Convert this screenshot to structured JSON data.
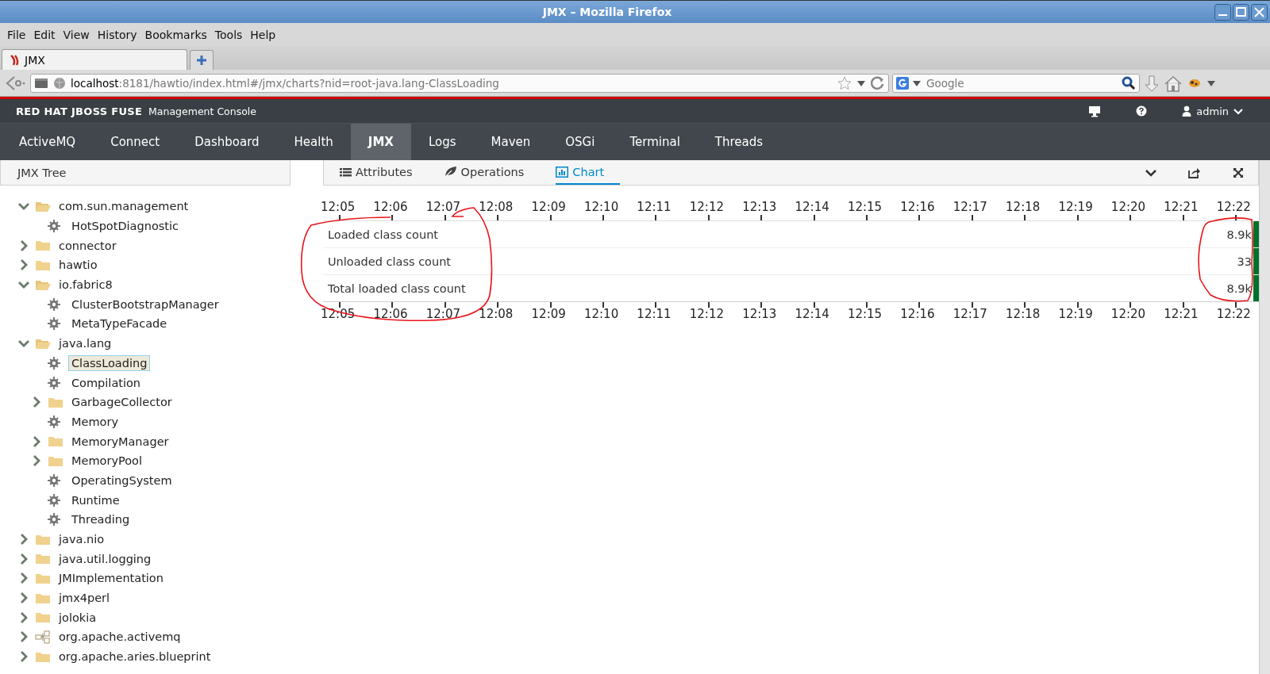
{
  "window": {
    "title": "JMX – Mozilla Firefox"
  },
  "menu": [
    "File",
    "Edit",
    "View",
    "History",
    "Bookmarks",
    "Tools",
    "Help"
  ],
  "browser_tabs": [
    {
      "title": "JMX",
      "selected": true
    }
  ],
  "address_bar": {
    "host": "localhost",
    "path": ":8181/hawtio/index.html#/jmx/charts?nid=root-java.lang-ClassLoading"
  },
  "search_field": {
    "placeholder": "Google"
  },
  "app_header": {
    "brand": "RED HAT JBOSS FUSE",
    "subtitle": "Management Console",
    "user": "admin"
  },
  "nav": {
    "tabs": [
      {
        "label": "ActiveMQ",
        "selected": false
      },
      {
        "label": "Connect",
        "selected": false
      },
      {
        "label": "Dashboard",
        "selected": false
      },
      {
        "label": "Health",
        "selected": false
      },
      {
        "label": "JMX",
        "selected": true
      },
      {
        "label": "Logs",
        "selected": false
      },
      {
        "label": "Maven",
        "selected": false
      },
      {
        "label": "OSGi",
        "selected": false
      },
      {
        "label": "Terminal",
        "selected": false
      },
      {
        "label": "Threads",
        "selected": false
      }
    ]
  },
  "sidebar": {
    "title": "JMX Tree"
  },
  "tree": {
    "items": [
      {
        "label": "com.sun.management",
        "kind": "folder",
        "expanded": true,
        "selected": false,
        "children": [
          {
            "label": "HotSpotDiagnostic",
            "kind": "mbean",
            "selected": false
          }
        ]
      },
      {
        "label": "connector",
        "kind": "folder",
        "expanded": false,
        "selected": false
      },
      {
        "label": "hawtio",
        "kind": "folder",
        "expanded": false,
        "selected": false
      },
      {
        "label": "io.fabric8",
        "kind": "folder",
        "expanded": true,
        "selected": false,
        "children": [
          {
            "label": "ClusterBootstrapManager",
            "kind": "mbean",
            "selected": false
          },
          {
            "label": "MetaTypeFacade",
            "kind": "mbean",
            "selected": false
          }
        ]
      },
      {
        "label": "java.lang",
        "kind": "folder",
        "expanded": true,
        "selected": false,
        "children": [
          {
            "label": "ClassLoading",
            "kind": "mbean",
            "selected": true
          },
          {
            "label": "Compilation",
            "kind": "mbean",
            "selected": false
          },
          {
            "label": "GarbageCollector",
            "kind": "folder",
            "expanded": false,
            "selected": false
          },
          {
            "label": "Memory",
            "kind": "mbean",
            "selected": false
          },
          {
            "label": "MemoryManager",
            "kind": "folder",
            "expanded": false,
            "selected": false
          },
          {
            "label": "MemoryPool",
            "kind": "folder",
            "expanded": false,
            "selected": false
          },
          {
            "label": "OperatingSystem",
            "kind": "mbean",
            "selected": false
          },
          {
            "label": "Runtime",
            "kind": "mbean",
            "selected": false
          },
          {
            "label": "Threading",
            "kind": "mbean",
            "selected": false
          }
        ]
      },
      {
        "label": "java.nio",
        "kind": "folder",
        "expanded": false,
        "selected": false
      },
      {
        "label": "java.util.logging",
        "kind": "folder",
        "expanded": false,
        "selected": false
      },
      {
        "label": "JMImplementation",
        "kind": "folder",
        "expanded": false,
        "selected": false
      },
      {
        "label": "jmx4perl",
        "kind": "folder",
        "expanded": false,
        "selected": false
      },
      {
        "label": "jolokia",
        "kind": "folder",
        "expanded": false,
        "selected": false
      },
      {
        "label": "org.apache.activemq",
        "kind": "package",
        "expanded": false,
        "selected": false
      },
      {
        "label": "org.apache.aries.blueprint",
        "kind": "folder",
        "expanded": false,
        "selected": false
      }
    ]
  },
  "subtabs": [
    {
      "label": "Attributes",
      "kind": "list",
      "selected": false
    },
    {
      "label": "Operations",
      "kind": "leaf",
      "selected": false
    },
    {
      "label": "Chart",
      "kind": "chart",
      "selected": true
    }
  ],
  "chart": {
    "axis_top": [
      "12:05",
      "12:06",
      "12:07",
      "12:08",
      "12:09",
      "12:10",
      "12:11",
      "12:12",
      "12:13",
      "12:14",
      "12:15",
      "12:16",
      "12:17",
      "12:18",
      "12:19",
      "12:20",
      "12:21",
      "12:22"
    ],
    "rows": [
      {
        "label": "Loaded class count",
        "value": "8.9k"
      },
      {
        "label": "Unloaded class count",
        "value": "33"
      },
      {
        "label": "Total loaded class count",
        "value": "8.9k"
      }
    ],
    "axis_bottom": [
      "12:05",
      "12:06",
      "12:07",
      "12:08",
      "12:09",
      "12:10",
      "12:11",
      "12:12",
      "12:13",
      "12:14",
      "12:15",
      "12:16",
      "12:17",
      "12:18",
      "12:19",
      "12:20",
      "12:21",
      "12:22"
    ]
  }
}
